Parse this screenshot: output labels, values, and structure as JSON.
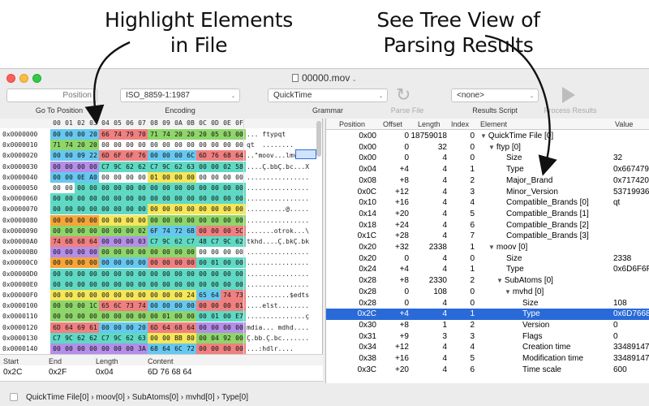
{
  "captions": {
    "left": [
      "Highlight Elements",
      "in File"
    ],
    "right": [
      "See Tree View of",
      "Parsing Results"
    ]
  },
  "window": {
    "title": "00000.mov"
  },
  "toolbar": {
    "goto": {
      "placeholder": "Position",
      "label": "Go To Position"
    },
    "encoding": {
      "value": "ISO_8859-1:1987",
      "label": "Encoding"
    },
    "grammar": {
      "value": "QuickTime",
      "label": "Grammar"
    },
    "parse": {
      "label": "Parse File"
    },
    "results_script": {
      "value": "<none>",
      "label": "Results Script"
    },
    "process": {
      "label": "Process Results"
    }
  },
  "hex": {
    "header": [
      "00",
      "01",
      "02",
      "03",
      "04",
      "05",
      "06",
      "07",
      "08",
      "09",
      "0A",
      "0B",
      "0C",
      "0D",
      "0E",
      "0F"
    ],
    "rows": [
      {
        "addr": "0x0000000",
        "bytes": "00 00 00 20 66 74 79 70 71 74 20 20 20 05 03 00",
        "colors": "BBBBRRRRGGGGGGGG",
        "ascii": "... ftypqt"
      },
      {
        "addr": "0x0000010",
        "bytes": "71 74 20 20 00 00 00 00 00 00 00 00 00 00 00 00",
        "colors": "GGGGWWWWWWWWWWWW",
        "ascii": "qt  ........"
      },
      {
        "addr": "0x0000020",
        "bytes": "00 00 09 22 6D 6F 6F 76 00 00 00 6C 6D 76 68 64",
        "colors": "BBBBRRRRBBBBRRRR",
        "ascii": "..\"moov...lmvhd"
      },
      {
        "addr": "0x0000030",
        "bytes": "00 00 00 00 C7 9C 62 62 C7 9C 62 63 00 00 02 58",
        "colors": "PPPPTTTTTTTTTTTT",
        "ascii": "....Ç.bbÇ.bc...X"
      },
      {
        "addr": "0x0000040",
        "bytes": "00 00 0E A0 00 00 00 00 01 00 00 00 00 00 00 00",
        "colors": "BBBBWWWWYYYYWWWW",
        "ascii": "................"
      },
      {
        "addr": "0x0000050",
        "bytes": "00 00 00 00 00 00 00 00 00 00 00 00 00 00 00 00",
        "colors": "WWTTTTTTTTTTTTTT",
        "ascii": "................"
      },
      {
        "addr": "0x0000060",
        "bytes": "00 00 00 00 00 00 00 00 00 00 00 00 00 00 00 00",
        "colors": "TTTTTTTTTTTTTTTT",
        "ascii": "................"
      },
      {
        "addr": "0x0000070",
        "bytes": "00 00 00 00 00 00 00 00 00 00 00 00 00 00 00 00",
        "colors": "TTTTTTTTYYYYYYYY",
        "ascii": "..........@....."
      },
      {
        "addr": "0x0000080",
        "bytes": "00 00 00 00 00 00 00 00 00 00 00 00 00 00 00 00",
        "colors": "OOOOYYYYGGGGGGGG",
        "ascii": "................"
      },
      {
        "addr": "0x0000090",
        "bytes": "00 00 00 00 00 00 00 02 6F 74 72 6B 00 00 00 5C",
        "colors": "GGGGGGGGBBBBRRRR",
        "ascii": ".......otrok...\\"
      },
      {
        "addr": "0x00000A0",
        "bytes": "74 6B 68 64 00 00 00 03 C7 9C 62 C7 48 C7 9C 62",
        "colors": "RRRRPPPPTTTTTTTT",
        "ascii": "tkhd....Ç.bkÇ.bk"
      },
      {
        "addr": "0x00000B0",
        "bytes": "00 00 00 00 00 00 00 00 00 00 00 00 00 00 00 00",
        "colors": "PPPPGGGGGGGGWWWW",
        "ascii": "................"
      },
      {
        "addr": "0x00000C0",
        "bytes": "00 00 00 00 00 00 00 00 00 00 00 00 00 01 00 00",
        "colors": "OOOOBBBBRRRRTTTT",
        "ascii": "................"
      },
      {
        "addr": "0x00000D0",
        "bytes": "00 00 00 00 00 00 00 00 00 00 00 00 00 00 00 00",
        "colors": "TTTTTTTTTTTTTTTT",
        "ascii": "................"
      },
      {
        "addr": "0x00000E0",
        "bytes": "00 00 00 00 00 00 00 00 00 00 00 00 00 00 00 00",
        "colors": "TTTTTTTTTTTTTTTT",
        "ascii": "................"
      },
      {
        "addr": "0x00000F0",
        "bytes": "00 00 00 00 00 00 00 00 00 00 00 24 65 64 74 73",
        "colors": "YYYYYYYYYYYYBBRR",
        "ascii": "...........$edts"
      },
      {
        "addr": "0x0000100",
        "bytes": "00 00 00 1C 65 6C 73 74 00 00 00 00 00 00 00 01",
        "colors": "GGGGRRRRBBBBRRRR",
        "ascii": "....elst........"
      },
      {
        "addr": "0x0000110",
        "bytes": "00 00 00 00 00 00 00 00 00 01 00 00 00 01 00 E7",
        "colors": "GGGGGGGGGGGGTTTT",
        "ascii": "...............ç"
      },
      {
        "addr": "0x0000120",
        "bytes": "6D 64 69 61 00 00 00 20 6D 64 68 64 00 00 00 00",
        "colors": "RRRRBBBBRRRRPPPP",
        "ascii": "mdia... mdhd...."
      },
      {
        "addr": "0x0000130",
        "bytes": "C7 9C 62 62 C7 9C 62 63 00 00 BB 80 00 04 92 00",
        "colors": "TTTTTTTTYYYYGGGG",
        "ascii": "Ç.bb.Ç.bc......."
      },
      {
        "addr": "0x0000140",
        "bytes": "00 00 00 00 00 00 00 3A 68 64 6C 72 00 00 00 00",
        "colors": "PPPPPPPPBBBBRRRR",
        "ascii": "...:hdlr...."
      }
    ],
    "highlight_colors": {
      "B": "#66c8f0",
      "R": "#f08080",
      "G": "#8ed66a",
      "T": "#5fd9c4",
      "P": "#b58ee8",
      "Y": "#f5e65a",
      "O": "#f5a53a",
      "W": "#ffffff"
    }
  },
  "info": {
    "headers": [
      "Start",
      "End",
      "Length",
      "Content"
    ],
    "values": [
      "0x2C",
      "0x2F",
      "0x04",
      "6D 76 68 64"
    ]
  },
  "tree": {
    "headers": [
      "Position",
      "Offset",
      "Length",
      "Index",
      "Element",
      "Value"
    ],
    "rows": [
      {
        "pos": "0x00",
        "off": "0",
        "len": "18759018",
        "idx": "0",
        "depth": 0,
        "tri": "▼",
        "el": "QuickTime File [0]",
        "val": ""
      },
      {
        "pos": "0x00",
        "off": "0",
        "len": "32",
        "idx": "0",
        "depth": 1,
        "tri": "▼",
        "el": "ftyp [0]",
        "val": ""
      },
      {
        "pos": "0x00",
        "off": "0",
        "len": "4",
        "idx": "0",
        "depth": 2,
        "tri": "",
        "el": "Size",
        "val": "32"
      },
      {
        "pos": "0x04",
        "off": "+4",
        "len": "4",
        "idx": "1",
        "depth": 2,
        "tri": "",
        "el": "Type",
        "val": "0x6674797"
      },
      {
        "pos": "0x08",
        "off": "+8",
        "len": "4",
        "idx": "2",
        "depth": 2,
        "tri": "",
        "el": "Major_Brand",
        "val": "0x717420"
      },
      {
        "pos": "0x0C",
        "off": "+12",
        "len": "4",
        "idx": "3",
        "depth": 2,
        "tri": "",
        "el": "Minor_Version",
        "val": "53719936"
      },
      {
        "pos": "0x10",
        "off": "+16",
        "len": "4",
        "idx": "4",
        "depth": 2,
        "tri": "",
        "el": "Compatible_Brands [0]",
        "val": "qt"
      },
      {
        "pos": "0x14",
        "off": "+20",
        "len": "4",
        "idx": "5",
        "depth": 2,
        "tri": "",
        "el": "Compatible_Brands [1]",
        "val": ""
      },
      {
        "pos": "0x18",
        "off": "+24",
        "len": "4",
        "idx": "6",
        "depth": 2,
        "tri": "",
        "el": "Compatible_Brands [2]",
        "val": ""
      },
      {
        "pos": "0x1C",
        "off": "+28",
        "len": "4",
        "idx": "7",
        "depth": 2,
        "tri": "",
        "el": "Compatible_Brands [3]",
        "val": ""
      },
      {
        "pos": "0x20",
        "off": "+32",
        "len": "2338",
        "idx": "1",
        "depth": 1,
        "tri": "▼",
        "el": "moov [0]",
        "val": ""
      },
      {
        "pos": "0x20",
        "off": "0",
        "len": "4",
        "idx": "0",
        "depth": 2,
        "tri": "",
        "el": "Size",
        "val": "2338"
      },
      {
        "pos": "0x24",
        "off": "+4",
        "len": "4",
        "idx": "1",
        "depth": 2,
        "tri": "",
        "el": "Type",
        "val": "0x6D6F6F"
      },
      {
        "pos": "0x28",
        "off": "+8",
        "len": "2330",
        "idx": "2",
        "depth": 2,
        "tri": "▼",
        "el": "SubAtoms [0]",
        "val": ""
      },
      {
        "pos": "0x28",
        "off": "0",
        "len": "108",
        "idx": "0",
        "depth": 3,
        "tri": "▼",
        "el": "mvhd [0]",
        "val": ""
      },
      {
        "pos": "0x28",
        "off": "0",
        "len": "4",
        "idx": "0",
        "depth": 4,
        "tri": "",
        "el": "Size",
        "val": "108"
      },
      {
        "pos": "0x2C",
        "off": "+4",
        "len": "4",
        "idx": "1",
        "depth": 4,
        "tri": "",
        "el": "Type",
        "val": "0x6D7668",
        "selected": true
      },
      {
        "pos": "0x30",
        "off": "+8",
        "len": "1",
        "idx": "2",
        "depth": 4,
        "tri": "",
        "el": "Version",
        "val": "0"
      },
      {
        "pos": "0x31",
        "off": "+9",
        "len": "3",
        "idx": "3",
        "depth": 4,
        "tri": "",
        "el": "Flags",
        "val": "0"
      },
      {
        "pos": "0x34",
        "off": "+12",
        "len": "4",
        "idx": "4",
        "depth": 4,
        "tri": "",
        "el": "Creation time",
        "val": "33489147"
      },
      {
        "pos": "0x38",
        "off": "+16",
        "len": "4",
        "idx": "5",
        "depth": 4,
        "tri": "",
        "el": "Modification time",
        "val": "33489147"
      },
      {
        "pos": "0x3C",
        "off": "+20",
        "len": "4",
        "idx": "6",
        "depth": 4,
        "tri": "",
        "el": "Time scale",
        "val": "600"
      }
    ]
  },
  "breadcrumb": {
    "path": "QuickTime File[0]  ›  moov[0]  ›  SubAtoms[0]  ›  mvhd[0]  ›  Type[0]"
  }
}
